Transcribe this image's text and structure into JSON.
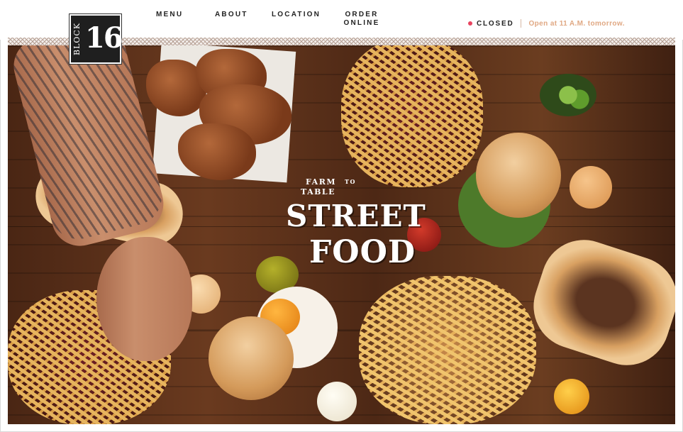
{
  "brand": {
    "logo_word": "BLOCK",
    "logo_number": "16"
  },
  "nav": {
    "items": [
      {
        "label": "MENU"
      },
      {
        "label": "ABOUT"
      },
      {
        "label": "LOCATION"
      },
      {
        "label": "ORDER ONLINE"
      }
    ]
  },
  "status": {
    "state": "CLOSED",
    "note": "Open at 11 A.M. tomorrow.",
    "dot_color": "#e8445f"
  },
  "hero": {
    "title_small_1": "FARM",
    "title_small_2": "TO",
    "title_small_3": "TABLE",
    "title_big_1": "STREET",
    "title_big_2": "FOOD"
  },
  "colors": {
    "accent": "#e0a883",
    "wood": "#5a2f18",
    "text_dark": "#222222"
  }
}
